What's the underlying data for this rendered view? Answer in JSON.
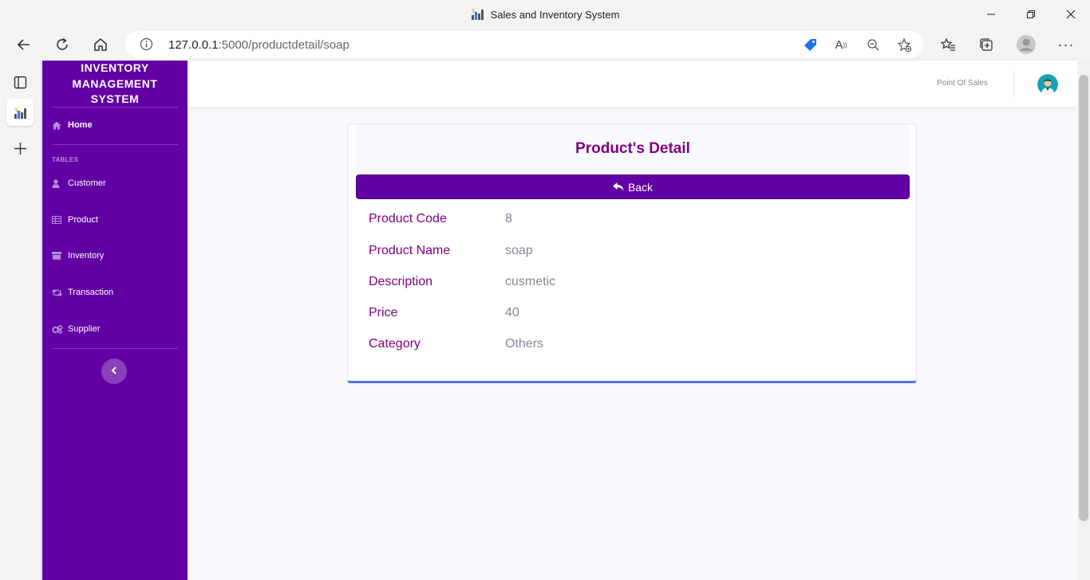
{
  "browser": {
    "window_title": "Sales and Inventory System",
    "url_host": "127.0.0.1",
    "url_rest": ":5000/productdetail/soap"
  },
  "sidebar": {
    "brand": "INVENTORY MANAGEMENT SYSTEM",
    "home_label": "Home",
    "section_heading": "TABLES",
    "items": [
      {
        "label": "Customer",
        "icon": "user-icon"
      },
      {
        "label": "Product",
        "icon": "table-icon"
      },
      {
        "label": "Inventory",
        "icon": "archive-icon"
      },
      {
        "label": "Transaction",
        "icon": "retweet-icon"
      },
      {
        "label": "Supplier",
        "icon": "cogs-icon"
      }
    ]
  },
  "topbar": {
    "link": "Point Of Sales"
  },
  "card": {
    "title": "Product's Detail",
    "back_label": "Back",
    "details": [
      {
        "label": "Product Code",
        "value": "8"
      },
      {
        "label": "Product Name",
        "value": "soap"
      },
      {
        "label": "Description",
        "value": "cusmetic"
      },
      {
        "label": "Price",
        "value": "40"
      },
      {
        "label": "Category",
        "value": "Others"
      }
    ]
  },
  "colors": {
    "sidebar": "#6200a6",
    "accent_text": "#800080",
    "value_text": "#858796",
    "card_border_bottom": "#4e73df"
  }
}
